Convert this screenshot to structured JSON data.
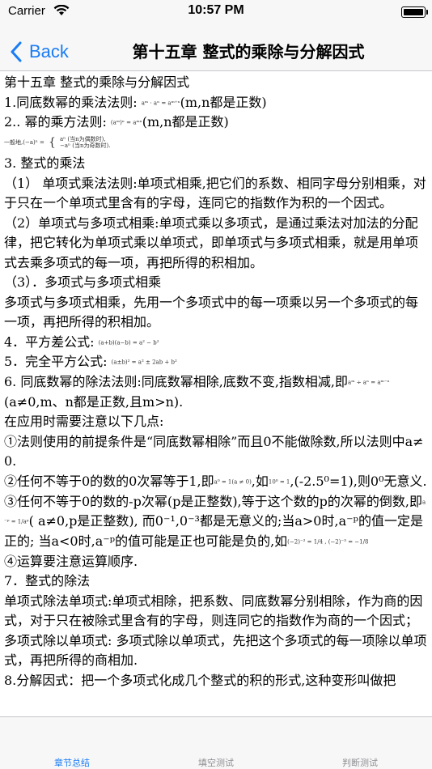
{
  "status_bar": {
    "carrier": "Carrier",
    "time": "10:57 PM"
  },
  "nav": {
    "back_label": "Back",
    "title": "第十五章 整式的乘除与分解因式"
  },
  "content": {
    "line_01": "第十五章  整式的乘除与分解因式",
    "line_02a": "1.同底数幂的乘法法则: ",
    "line_02f": "aᵐ · aⁿ = aᵐ⁺ⁿ",
    "line_02b": "(m,n都是正数)",
    "line_03a": "2.. 幂的乘方法则: ",
    "line_03f": "(aᵐ)ⁿ = aᵐⁿ",
    "line_03b": "(m,n都是正数)",
    "line_04a": "一般地,(−a)ⁿ =",
    "line_04b": "aⁿ (当n为偶数时),",
    "line_04c": "−aⁿ (当n为奇数时).",
    "line_05": "3. 整式的乘法",
    "line_06": "（1） 单项式乘法法则:单项式相乘,把它们的系数、相同字母分别相乘，对于只在一个单项式里含有的字母，连同它的指数作为积的一个因式。",
    "line_07": "（2）单项式与多项式相乘:单项式乘以多项式，是通过乘法对加法的分配律，把它转化为单项式乘以单项式，即单项式与多项式相乘，就是用单项式去乘多项式的每一项，再把所得的积相加。",
    "line_08": "（3）．多项式与多项式相乘",
    "line_09": "多项式与多项式相乘，先用一个多项式中的每一项乘以另一个多项式的每一项，再把所得的积相加。",
    "line_10a": "4．平方差公式: ",
    "line_10f": "(a+b)(a−b) = a² − b²",
    "line_11a": "5．完全平方公式: ",
    "line_11f": "(a±b)² = a² ± 2ab + b²",
    "line_12a": "6. 同底数幂的除法法则:同底数幂相除,底数不变,指数相减,即",
    "line_12f": "aᵐ ÷ aⁿ = aᵐ⁻ⁿ",
    "line_12b": "(a≠0,m、n都是正数,且m>n).",
    "line_13": "在应用时需要注意以下几点:",
    "line_14": "①法则使用的前提条件是“同底数幂相除”而且0不能做除数,所以法则中a≠0.",
    "line_15a": "②任何不等于0的数的0次幂等于1,即",
    "line_15f": "a⁰ = 1(a ≠ 0)",
    "line_15b": ",如",
    "line_15g": "10⁰ = 1",
    "line_15c": ",(-2.5⁰=1),则0⁰无意义.",
    "line_16a": "③任何不等于0的数的-p次幂(p是正整数),等于这个数的p的次幂的倒数,即",
    "line_16f": "a⁻ᵖ = 1/aᵖ",
    "line_16b": "( a≠0,p是正整数), 而0⁻¹,0⁻³都是无意义的;当a>0时,a⁻ᵖ的值一定是正的; 当a<0时,a⁻ᵖ的值可能是正也可能是负的,如",
    "line_16g": "(−2)⁻² = 1/4 , (−2)⁻³ = −1/8",
    "line_17": "④运算要注意运算顺序.",
    "line_18": "7．整式的除法",
    "line_19": "单项式除法单项式:单项式相除，把系数、同底数幂分别相除，作为商的因式，对于只在被除式里含有的字母，则连同它的指数作为商的一个因式；",
    "line_20": "多项式除以单项式: 多项式除以单项式，先把这个多项式的每一项除以单项式，再把所得的商相加.",
    "line_21": "8.分解因式：把一个多项式化成几个整式的积的形式,这种变形叫做把"
  },
  "tabs": [
    {
      "label": "章节总结",
      "active": true
    },
    {
      "label": "填空测试",
      "active": false
    },
    {
      "label": "判断测试",
      "active": false
    }
  ],
  "colors": {
    "accent": "#1a7cf5",
    "inactive_tab": "#8e8e93",
    "bar_bg": "#f7f7f7"
  }
}
